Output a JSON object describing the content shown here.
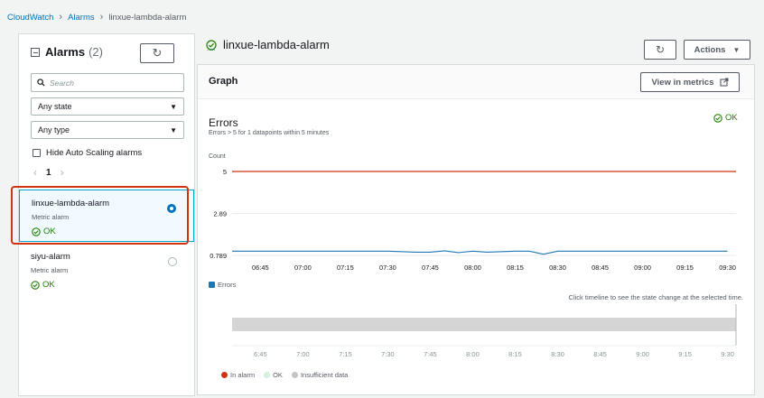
{
  "breadcrumb": {
    "root": "CloudWatch",
    "section": "Alarms",
    "current": "linxue-lambda-alarm"
  },
  "left_panel": {
    "title": "Alarms",
    "count": "(2)",
    "search_placeholder": "Search",
    "state_filter": "Any state",
    "type_filter": "Any type",
    "hide_autoscaling_label": "Hide Auto Scaling alarms",
    "page": "1",
    "alarms": [
      {
        "name": "linxue-lambda-alarm",
        "type": "Metric alarm",
        "status": "OK",
        "selected": true
      },
      {
        "name": "siyu-alarm",
        "type": "Metric alarm",
        "status": "OK",
        "selected": false
      }
    ]
  },
  "header": {
    "alarm_name": "linxue-lambda-alarm",
    "actions_label": "Actions"
  },
  "graph": {
    "title": "Graph",
    "view_in_metrics": "View in metrics",
    "metric_name": "Errors",
    "condition": "Errors > 5 for 1 datapoints within 5 minutes",
    "status": "OK",
    "timeline_hint": "Click timeline to see the state change at the selected time."
  },
  "colors": {
    "threshold": "#d13212",
    "series": "#1f77b4",
    "ok": "#1d8102",
    "link": "#0073bb"
  },
  "chart_data": {
    "type": "line",
    "ylabel": "Count",
    "y_ticks": [
      "5",
      "2.89",
      "0.789"
    ],
    "threshold": 5,
    "ylim": [
      0.789,
      5
    ],
    "x_ticks": [
      "06:45",
      "07:00",
      "07:15",
      "07:30",
      "07:45",
      "08:00",
      "08:15",
      "08:30",
      "08:45",
      "09:00",
      "09:15",
      "09:30"
    ],
    "series": [
      {
        "name": "Errors",
        "points": [
          {
            "x": "06:35",
            "y": 1.0
          },
          {
            "x": "06:45",
            "y": 1.0
          },
          {
            "x": "07:00",
            "y": 1.0
          },
          {
            "x": "07:15",
            "y": 1.0
          },
          {
            "x": "07:30",
            "y": 1.0
          },
          {
            "x": "07:40",
            "y": 0.95
          },
          {
            "x": "07:45",
            "y": 0.95
          },
          {
            "x": "07:50",
            "y": 1.02
          },
          {
            "x": "07:55",
            "y": 0.93
          },
          {
            "x": "08:00",
            "y": 1.0
          },
          {
            "x": "08:05",
            "y": 0.95
          },
          {
            "x": "08:15",
            "y": 1.0
          },
          {
            "x": "08:20",
            "y": 1.0
          },
          {
            "x": "08:25",
            "y": 0.85
          },
          {
            "x": "08:30",
            "y": 1.0
          },
          {
            "x": "08:45",
            "y": 1.0
          },
          {
            "x": "09:00",
            "y": 1.0
          },
          {
            "x": "09:15",
            "y": 1.0
          },
          {
            "x": "09:30",
            "y": 1.0
          }
        ]
      }
    ],
    "timeline_ticks": [
      "6:45",
      "7:00",
      "7:15",
      "7:30",
      "7:45",
      "8:00",
      "8:15",
      "8:30",
      "8:45",
      "9:00",
      "9:15",
      "9:30"
    ],
    "timeline_legend": [
      "In alarm",
      "OK",
      "Insufficient data"
    ]
  }
}
